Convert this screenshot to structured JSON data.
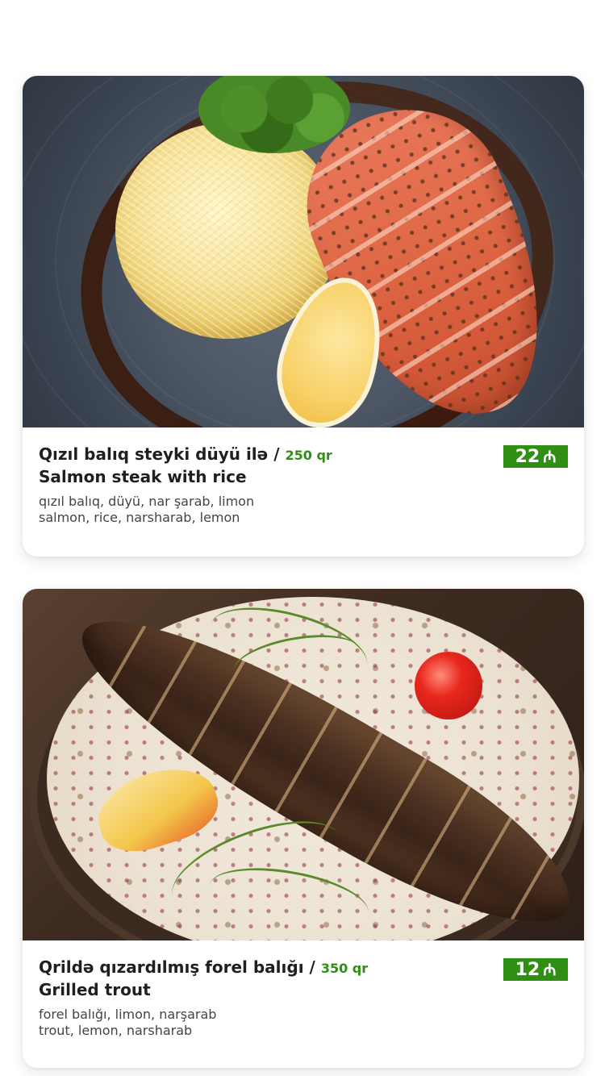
{
  "menu_items": [
    {
      "title_az": "Qızıl balıq steyki düyü ilə /",
      "weight": "250 qr",
      "title_en": "Salmon steak with rice",
      "ingredients_az": "qızıl balıq, düyü, nar şarab, limon",
      "ingredients_en": "salmon, rice, narsharab, lemon",
      "price": "22",
      "currency_icon": "manat-icon",
      "currency_symbol": "₼"
    },
    {
      "title_az": "Qrildə qızardılmış forel balığı /",
      "weight": "350 qr",
      "title_en": "Grilled trout",
      "ingredients_az": "forel balığı, limon, narşarab",
      "ingredients_en": "trout, lemon, narsharab",
      "price": "12",
      "currency_icon": "manat-icon",
      "currency_symbol": "₼"
    }
  ],
  "colors": {
    "accent_green": "#2f8f13",
    "card_bg": "#ffffff",
    "text": "#1f1f1f"
  }
}
